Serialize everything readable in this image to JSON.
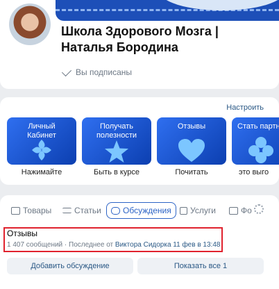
{
  "group": {
    "title": "Школа Здорового Мозга | Наталья Бородина",
    "subscribed_label": "Вы подписаны"
  },
  "cards": {
    "setup_label": "Настроить",
    "items": [
      {
        "text": "Личный\nКабинет",
        "caption": "Нажимайте",
        "icon": "plus-petal-icon"
      },
      {
        "text": "Получать\nполезности",
        "caption": "Быть в курсе",
        "icon": "star-icon"
      },
      {
        "text": "Отзывы",
        "caption": "Почитать",
        "icon": "heart-icon"
      },
      {
        "text": "Стать партн",
        "caption": "это выго",
        "icon": "flower-icon"
      }
    ]
  },
  "tabs": {
    "items": [
      {
        "label": "Товары",
        "icon": "bag-icon"
      },
      {
        "label": "Статьи",
        "icon": "article-icon"
      },
      {
        "label": "Обсуждения",
        "icon": "chat-bubble-icon",
        "active": true
      },
      {
        "label": "Услуги",
        "icon": "checkbox-icon"
      },
      {
        "label": "Фо",
        "icon": "photo-icon"
      }
    ]
  },
  "topic": {
    "title": "Отзывы",
    "meta_prefix": "1 407 сообщений · Последнее от",
    "meta_author": "Виктора Сидорка 11 фев в 13:48"
  },
  "buttons": {
    "add": "Добавить обсуждение",
    "show_all": "Показать все 1"
  },
  "colors": {
    "accent": "#2d64c6",
    "card_blue": "#1e56d6",
    "highlight": "#e0222e"
  }
}
